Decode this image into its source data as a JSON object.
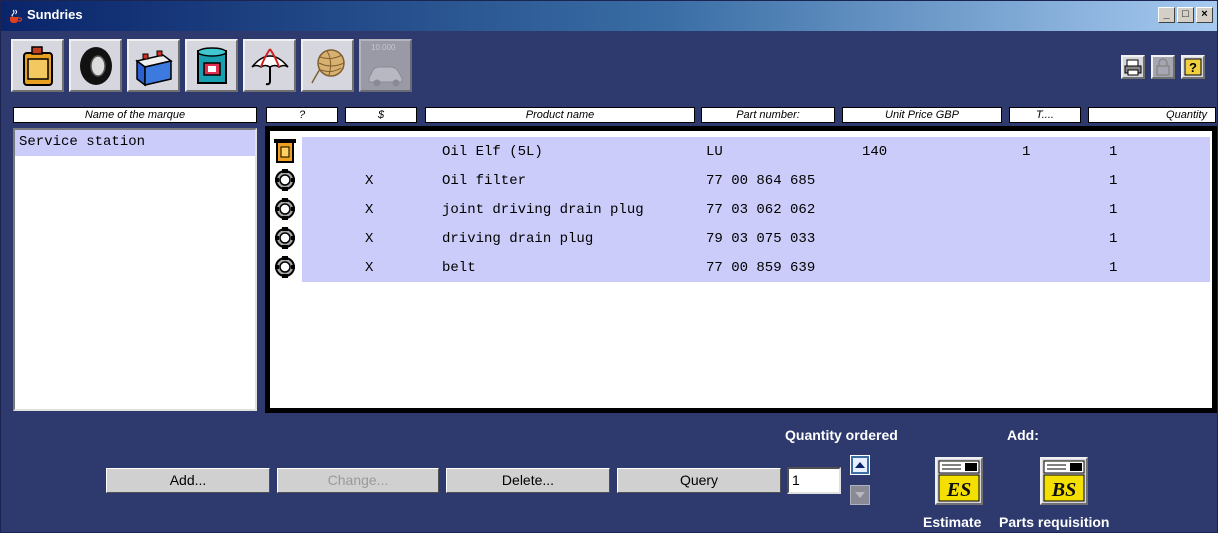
{
  "window": {
    "title": "Sundries"
  },
  "toolbar": {
    "category_buttons": [
      {
        "icon": "oil-can-icon"
      },
      {
        "icon": "tyre-icon"
      },
      {
        "icon": "battery-icon"
      },
      {
        "icon": "paint-can-icon"
      },
      {
        "icon": "umbrella-icon"
      },
      {
        "icon": "yarn-ball-icon"
      },
      {
        "icon": "car-service-10000-icon",
        "label": "10.000",
        "disabled": true
      }
    ]
  },
  "columns": {
    "marque": "Name of the marque",
    "q": "?",
    "s": "$",
    "product": "Product name",
    "part": "Part number:",
    "price": "Unit Price GBP",
    "t": "T....",
    "qty": "Quantity"
  },
  "marque_list": [
    "Service station"
  ],
  "rows": [
    {
      "icon": "oil-container-icon",
      "flag": "",
      "product": "Oil Elf (5L)",
      "part": "LU",
      "price": "140",
      "t": "1",
      "qty": "1"
    },
    {
      "icon": "gear-part-icon",
      "flag": "X",
      "product": "Oil filter",
      "part": "77 00 864 685",
      "price": "",
      "t": "",
      "qty": "1"
    },
    {
      "icon": "gear-part-icon",
      "flag": "X",
      "product": "joint driving drain plug",
      "part": "77 03 062 062",
      "price": "",
      "t": "",
      "qty": "1"
    },
    {
      "icon": "gear-part-icon",
      "flag": "X",
      "product": "driving drain plug",
      "part": "79 03 075 033",
      "price": "",
      "t": "",
      "qty": "1"
    },
    {
      "icon": "gear-part-icon",
      "flag": "X",
      "product": "belt",
      "part": "77 00 859 639",
      "price": "",
      "t": "",
      "qty": "1"
    }
  ],
  "buttons": {
    "add": "Add...",
    "change": "Change...",
    "delete": "Delete...",
    "query": "Query"
  },
  "quantity_ordered": {
    "label": "Quantity ordered",
    "value": "1"
  },
  "add_section": {
    "label": "Add:",
    "estimate": "Estimate",
    "parts_requisition": "Parts requisition"
  },
  "colors": {
    "background": "#2e3a6e",
    "row_highlight": "#ccccfa"
  }
}
